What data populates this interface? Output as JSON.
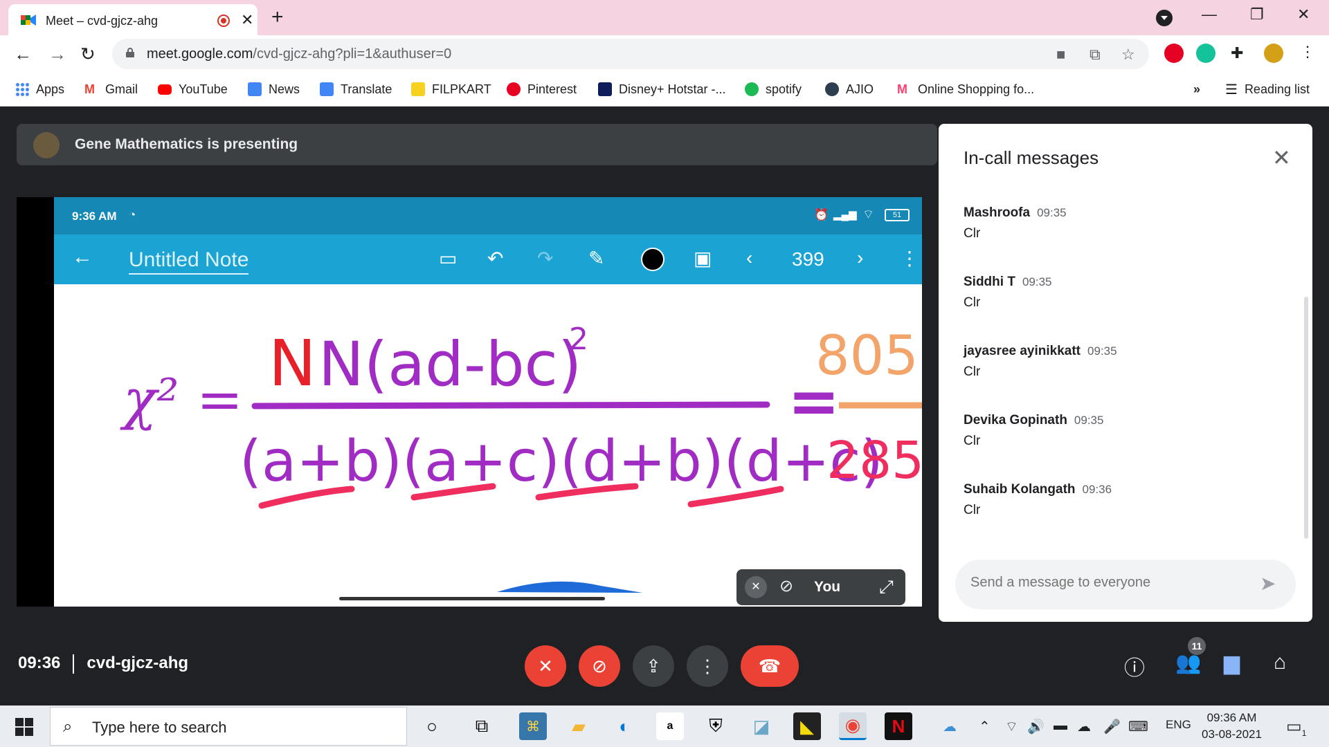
{
  "browser": {
    "tab_title": "Meet – cvd-gjcz-ahg",
    "url_host": "meet.google.com",
    "url_path": "/cvd-gjcz-ahg?pli=1&authuser=0"
  },
  "bookmarks": [
    {
      "label": "Apps",
      "icon": "apps-grid-icon",
      "color": "#4285f4"
    },
    {
      "label": "Gmail",
      "icon": "gmail-icon",
      "color": "#ea4335"
    },
    {
      "label": "YouTube",
      "icon": "youtube-icon",
      "color": "#ff0000"
    },
    {
      "label": "News",
      "icon": "news-icon",
      "color": "#4285f4"
    },
    {
      "label": "Translate",
      "icon": "translate-icon",
      "color": "#4285f4"
    },
    {
      "label": "FILPKART",
      "icon": "flipkart-icon",
      "color": "#f7d11f"
    },
    {
      "label": "Pinterest",
      "icon": "pinterest-icon",
      "color": "#e60023"
    },
    {
      "label": "Disney+ Hotstar -...",
      "icon": "hotstar-icon",
      "color": "#0f1e5a"
    },
    {
      "label": "spotify",
      "icon": "spotify-icon",
      "color": "#1db954"
    },
    {
      "label": "AJIO",
      "icon": "ajio-icon",
      "color": "#2c3e50"
    },
    {
      "label": "Online Shopping fo...",
      "icon": "myntra-icon",
      "color": "#ff3f6c"
    }
  ],
  "bookmarks_overflow": "»",
  "reading_list": "Reading list",
  "meet": {
    "presenting_text": "Gene Mathematics is presenting",
    "time": "09:36",
    "meeting_code": "cvd-gjcz-ahg",
    "self_label": "You",
    "participants_count": "11"
  },
  "shared_screen": {
    "phone_time": "9:36 AM",
    "battery": "51",
    "note_title": "Untitled Note",
    "page_number": "399",
    "formula_lhs": "χ² =",
    "formula_numerator": "N(ad-bc)",
    "formula_exponent": "2",
    "formula_denominator": "(a+b)(a+c)(d+b)(d+c)",
    "formula_equals": "=",
    "value_top": "805",
    "value_bottom": "285"
  },
  "chat": {
    "title": "In-call messages",
    "messages": [
      {
        "sender": "Mashroofa",
        "time": "09:35",
        "text": "Clr"
      },
      {
        "sender": "Siddhi T",
        "time": "09:35",
        "text": "Clr"
      },
      {
        "sender": "jayasree ayinikkatt",
        "time": "09:35",
        "text": "Clr"
      },
      {
        "sender": "Devika Gopinath",
        "time": "09:35",
        "text": "Clr"
      },
      {
        "sender": "Suhaib Kolangath",
        "time": "09:36",
        "text": "Clr"
      }
    ],
    "placeholder": "Send a message to everyone"
  },
  "taskbar": {
    "search_placeholder": "Type here to search",
    "language": "ENG",
    "clock_time": "09:36 AM",
    "clock_date": "03-08-2021",
    "notification_count": "1"
  }
}
